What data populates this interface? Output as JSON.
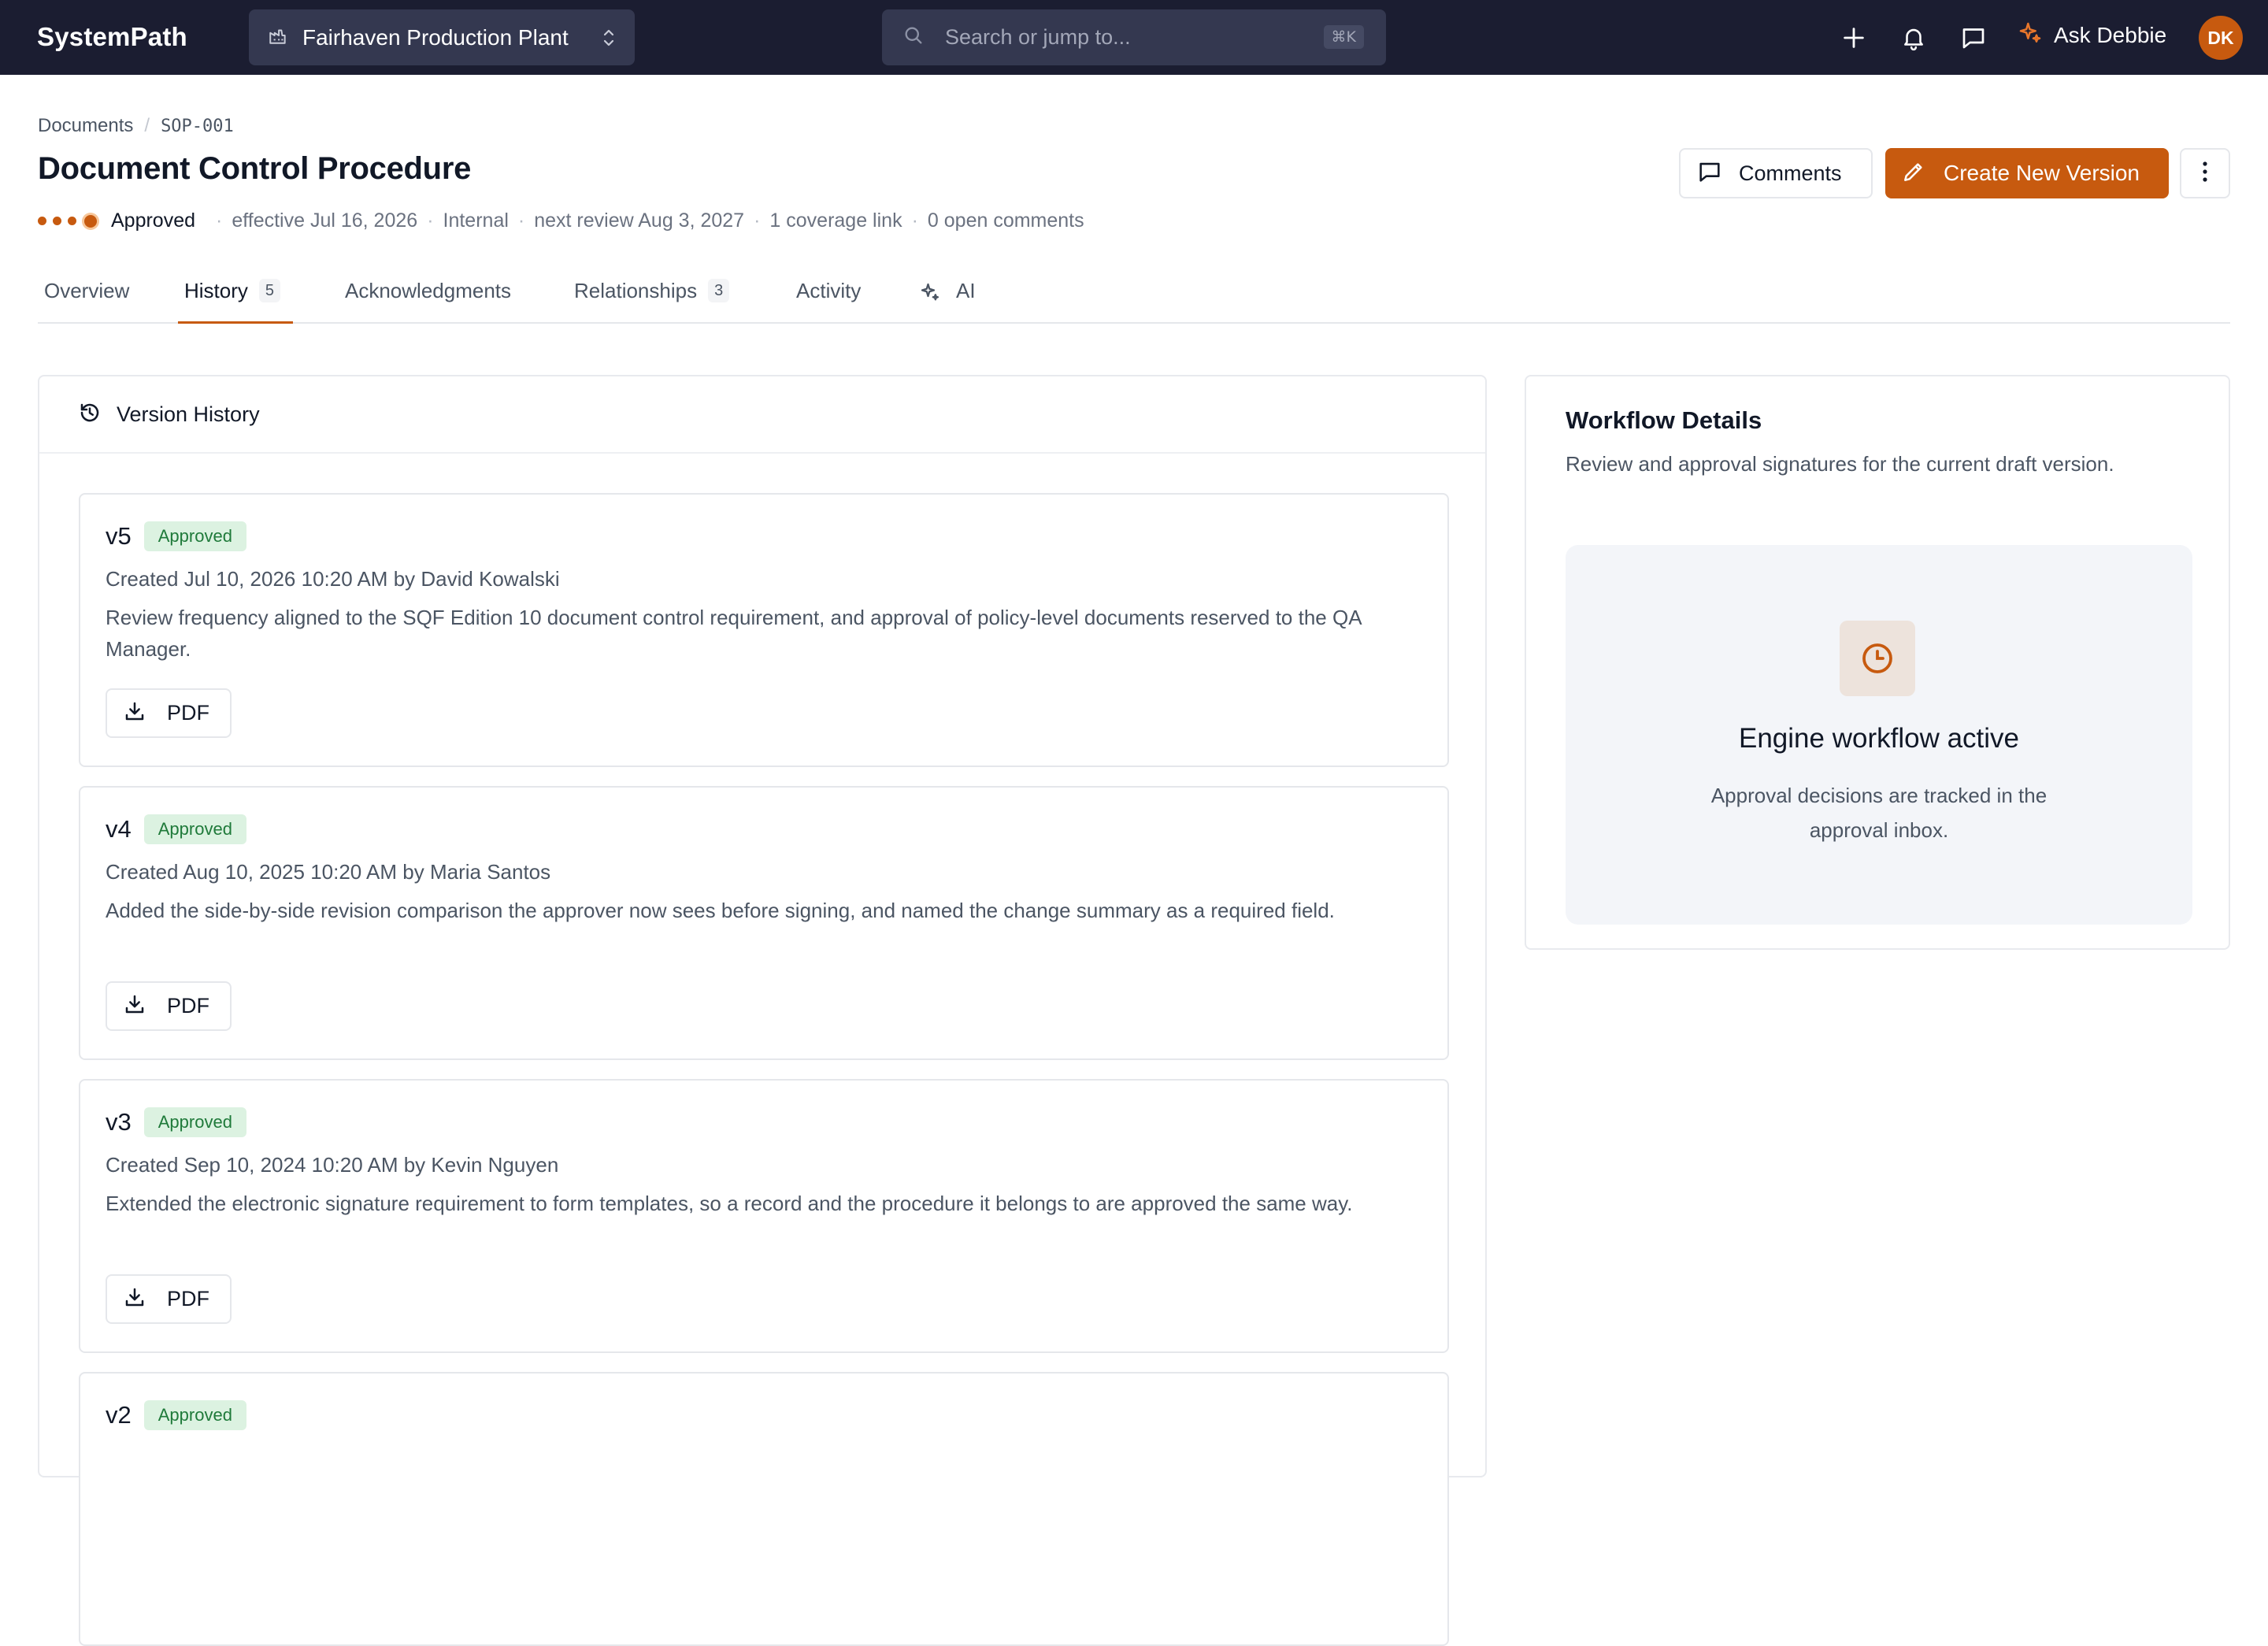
{
  "topbar": {
    "brand": "SystemPath",
    "site": "Fairhaven Production Plant",
    "search_placeholder": "Search or jump to...",
    "search_shortcut": "⌘K",
    "ask_label": "Ask Debbie",
    "avatar_initials": "DK"
  },
  "breadcrumb": {
    "root": "Documents",
    "current": "SOP-001"
  },
  "document": {
    "title": "Document Control Procedure",
    "status": "Approved",
    "effective": "effective Jul 16, 2026",
    "classification": "Internal",
    "next_review": "next review Aug 3, 2027",
    "coverage": "1 coverage link",
    "comments": "0 open comments"
  },
  "actions": {
    "comments": "Comments",
    "create_version": "Create New Version"
  },
  "tabs": [
    {
      "label": "Overview"
    },
    {
      "label": "History",
      "count": "5"
    },
    {
      "label": "Acknowledgments"
    },
    {
      "label": "Relationships",
      "count": "3"
    },
    {
      "label": "Activity"
    },
    {
      "label": "AI"
    }
  ],
  "version_history": {
    "title": "Version History",
    "versions": [
      {
        "name": "v5",
        "status": "Approved",
        "created": "Created Jul 10, 2026 10:20 AM by David Kowalski",
        "summary": "Review frequency aligned to the SQF Edition 10 document control requirement, and approval of policy-level documents reserved to the QA Manager.",
        "pdf": "PDF"
      },
      {
        "name": "v4",
        "status": "Approved",
        "created": "Created Aug 10, 2025 10:20 AM by Maria Santos",
        "summary": "Added the side-by-side revision comparison the approver now sees before signing, and named the change summary as a required field.",
        "pdf": "PDF"
      },
      {
        "name": "v3",
        "status": "Approved",
        "created": "Created Sep 10, 2024 10:20 AM by Kevin Nguyen",
        "summary": "Extended the electronic signature requirement to form templates, so a record and the procedure it belongs to are approved the same way.",
        "pdf": "PDF"
      },
      {
        "name": "v2",
        "status": "Approved"
      }
    ]
  },
  "workflow": {
    "title": "Workflow Details",
    "subtitle": "Review and approval signatures for the current draft version.",
    "state_heading": "Engine workflow active",
    "state_text": "Approval decisions are tracked in the approval inbox."
  },
  "colors": {
    "accent": "#c75a0f",
    "topbar": "#1b1d31",
    "badge_bg": "#dcf2e1",
    "badge_text": "#1f7a3a"
  }
}
